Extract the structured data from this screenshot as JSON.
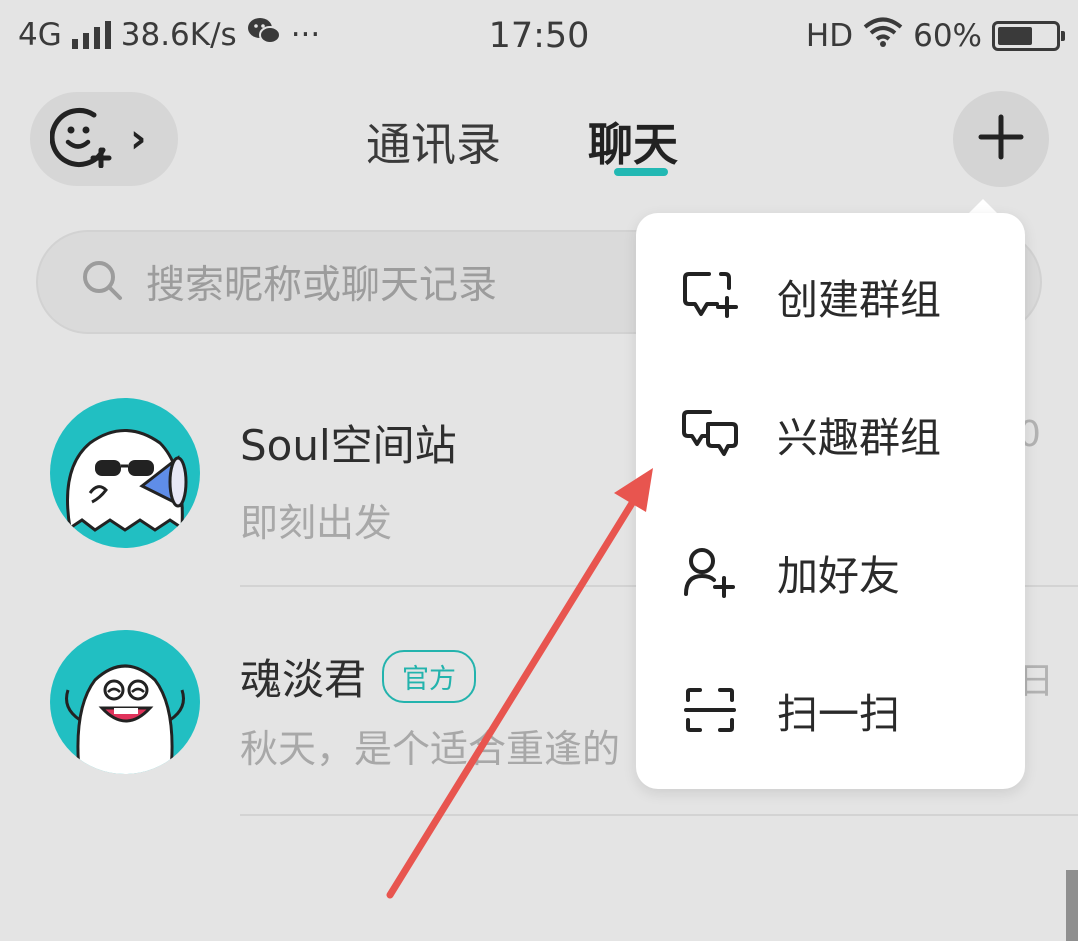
{
  "status_bar": {
    "network": "4G",
    "speed": "38.6K/s",
    "more": "···",
    "time": "17:50",
    "hd": "HD",
    "battery_text": "60%",
    "battery_level": 0.6
  },
  "header": {
    "tab_contacts": "通讯录",
    "tab_chat": "聊天",
    "active_tab": "聊天",
    "chevron": "›",
    "accent_color": "#22b8b3"
  },
  "search": {
    "placeholder": "搜索昵称或聊天记录"
  },
  "conversations": [
    {
      "name": "Soul空间站",
      "message": "即刻出发",
      "time_fragment": "0",
      "badge": ""
    },
    {
      "name": "魂淡君",
      "message": "秋天，是个适合重逢的",
      "time_fragment": "日",
      "badge": "官方"
    }
  ],
  "menu": {
    "items": [
      {
        "label": "创建群组",
        "icon": "chat-bubble-plus-icon"
      },
      {
        "label": "兴趣群组",
        "icon": "double-chat-bubble-icon"
      },
      {
        "label": "加好友",
        "icon": "add-friend-icon"
      },
      {
        "label": "扫一扫",
        "icon": "scan-icon"
      }
    ]
  },
  "annotation": {
    "color": "#e8554f"
  }
}
